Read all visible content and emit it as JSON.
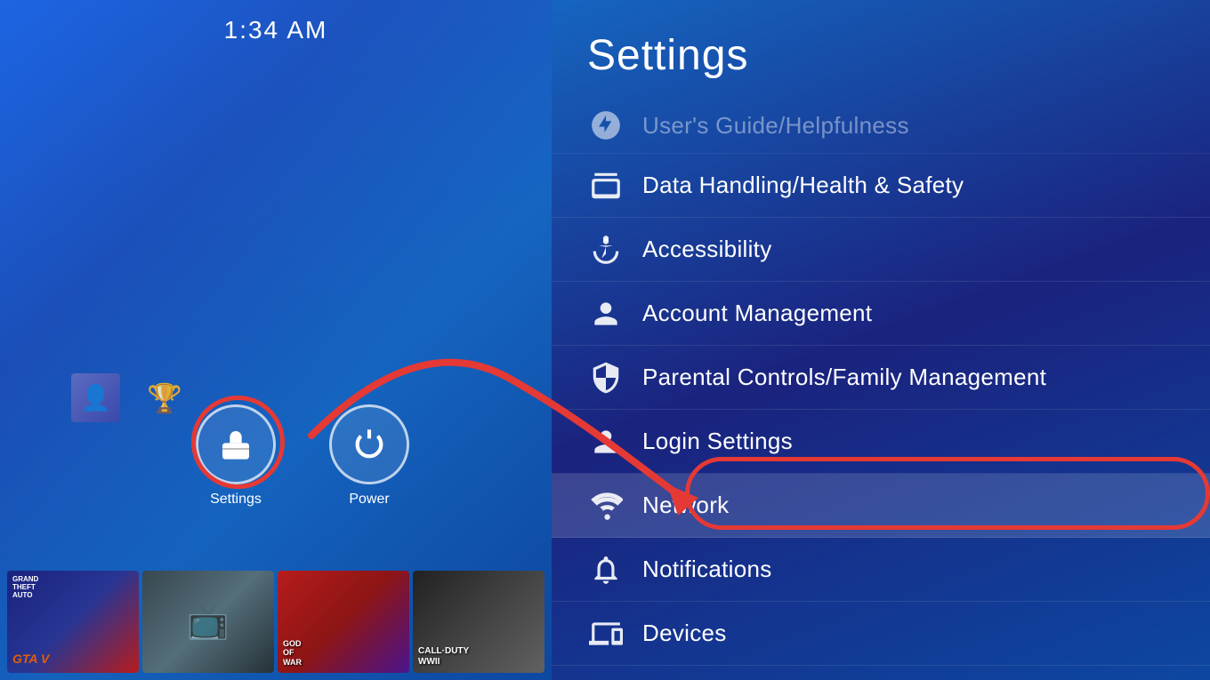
{
  "time": "1:34 AM",
  "left": {
    "settings_label": "Settings",
    "power_label": "Power"
  },
  "games": [
    {
      "id": "gta",
      "title": "Grand Theft Auto V",
      "short": "GRAND\nTHEFT\nAUTO V"
    },
    {
      "id": "tv",
      "title": "TV",
      "short": ""
    },
    {
      "id": "gow",
      "title": "God of War",
      "short": "GOD\nOF\nWAR"
    },
    {
      "id": "cod",
      "title": "Call of Duty WWII",
      "short": "CALL OF DUTY\nWWII"
    }
  ],
  "settings": {
    "title": "Settings",
    "items": [
      {
        "id": "users-guide",
        "label": "User's Guide/Helpfulness",
        "partial": true
      },
      {
        "id": "data-handling",
        "label": "Data Handling/Health & Safety",
        "active": false
      },
      {
        "id": "accessibility",
        "label": "Accessibility",
        "active": false
      },
      {
        "id": "account-management",
        "label": "Account Management",
        "active": false
      },
      {
        "id": "parental-controls",
        "label": "Parental Controls/Family Management",
        "active": false
      },
      {
        "id": "login-settings",
        "label": "Login Settings",
        "active": false
      },
      {
        "id": "network",
        "label": "Network",
        "active": true
      },
      {
        "id": "notifications",
        "label": "Notifications",
        "active": false
      },
      {
        "id": "devices",
        "label": "Devices",
        "active": false
      }
    ]
  }
}
